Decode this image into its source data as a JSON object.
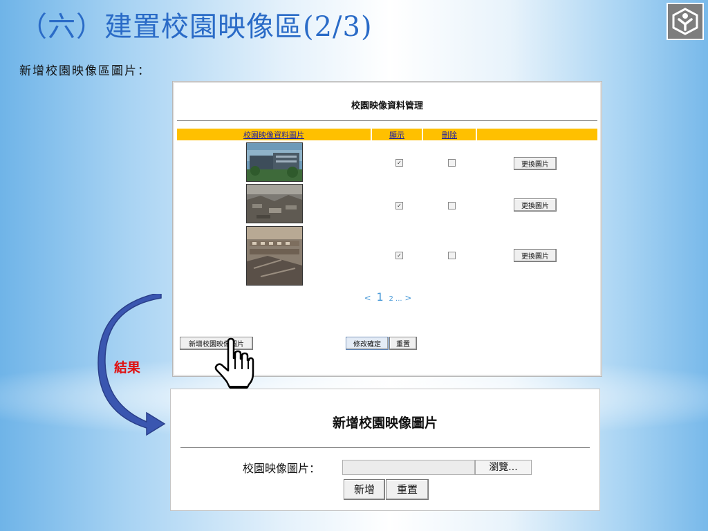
{
  "slide": {
    "title": "（六）建置校園映像區(2/3)",
    "subtitle": "新增校園映像區圖片："
  },
  "panel1": {
    "title": "校園映像資料管理",
    "headers": [
      "校園映像資料圖片",
      "顯示",
      "刪除"
    ],
    "rows": [
      {
        "show": "✓",
        "delete": "",
        "button": "更換圖片"
      },
      {
        "show": "✓",
        "delete": "",
        "button": "更換圖片"
      },
      {
        "show": "✓",
        "delete": "",
        "button": "更換圖片"
      }
    ],
    "pager": {
      "prev": "<",
      "current": "1",
      "next_pages": "2 ...",
      "next": ">"
    },
    "add_button": "新增校園映像圖片",
    "confirm_button": "修改確定",
    "reset_button": "重置"
  },
  "annotation": {
    "label": "結果",
    "arrow_color": "#3a56b0",
    "label_color": "#e01010"
  },
  "panel2": {
    "title": "新增校園映像圖片",
    "field_label": "校園映像圖片：",
    "browse_button": "瀏覽...",
    "add_button": "新增",
    "reset_button": "重置"
  },
  "colors": {
    "title": "#2a6bc7",
    "table_header": "#ffc000",
    "header_link": "#2020a0",
    "pager": "#4a9ad8"
  },
  "icons": {
    "logo": "organization-logo-icon",
    "cursor": "hand-pointer-icon",
    "arrow": "curved-arrow-icon"
  }
}
